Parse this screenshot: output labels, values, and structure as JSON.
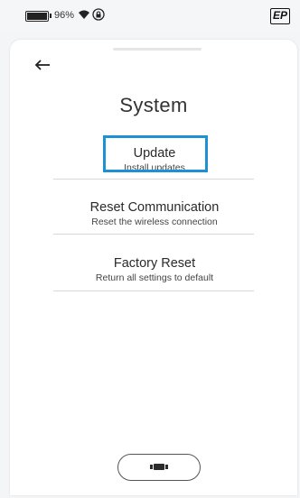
{
  "status_bar": {
    "battery_percent": "96%"
  },
  "header": {
    "title": "System",
    "logo_text": "EP"
  },
  "menu": {
    "items": [
      {
        "label": "Update",
        "description": "Install updates"
      },
      {
        "label": "Reset Communication",
        "description": "Reset the wireless connection"
      },
      {
        "label": "Factory Reset",
        "description": "Return all settings to default"
      }
    ]
  },
  "colors": {
    "highlight": "#1e90d6",
    "background": "#f3f5f7",
    "card": "#ffffff"
  },
  "icons": {
    "status": [
      "battery-icon",
      "wifi-icon",
      "lock-icon"
    ],
    "navigation": [
      "back-arrow-icon",
      "home-button-icon"
    ]
  }
}
